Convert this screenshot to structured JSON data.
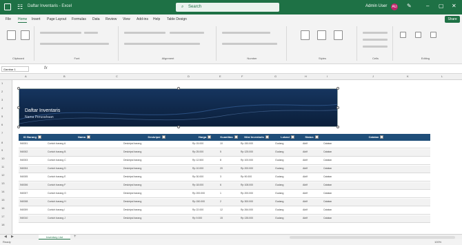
{
  "titlebar": {
    "doc_title": "Daftar Inventaris - Excel",
    "search_placeholder": "Search",
    "user_name": "Admin User",
    "avatar_initials": "AU",
    "accent": "#1e7145"
  },
  "menu": {
    "tabs": [
      "File",
      "Home",
      "Insert",
      "Page Layout",
      "Formulas",
      "Data",
      "Review",
      "View",
      "Add-ins",
      "Help",
      "Table Design"
    ],
    "active_index": 1,
    "share_label": "Share"
  },
  "ribbon": {
    "groups": [
      "Clipboard",
      "Font",
      "Alignment",
      "Number",
      "Styles",
      "Cells",
      "Editing"
    ]
  },
  "formula": {
    "namebox": "Gambar 1",
    "fx": "fx"
  },
  "sheet": {
    "columns": [
      "A",
      "B",
      "C",
      "D",
      "E",
      "F",
      "G",
      "H",
      "I",
      "J",
      "K",
      "L"
    ],
    "rows": [
      "1",
      "2",
      "3",
      "4",
      "5",
      "6",
      "7",
      "8",
      "9",
      "10",
      "11",
      "12",
      "13",
      "14",
      "15",
      "16",
      "17",
      "18"
    ]
  },
  "banner": {
    "title": "Daftar Inventaris",
    "subtitle": "Nama Perusahaan"
  },
  "table": {
    "header_color": "#1f4e79",
    "headers": [
      "ID Barang",
      "Nama",
      "Deskripsi",
      "Harga",
      "Kuantitas",
      "Nilai Inventaris",
      "Lokasi",
      "Status",
      "Catatan"
    ],
    "rows": [
      [
        "IN0001",
        "Contoh barang A",
        "Deskripsi barang",
        "Rp 15.000",
        "10",
        "Rp 150.000",
        "Gudang",
        "Aktif",
        "Catatan"
      ],
      [
        "IN0002",
        "Contoh barang B",
        "Deskripsi barang",
        "Rp 25.000",
        "5",
        "Rp 125.000",
        "Gudang",
        "Aktif",
        "Catatan"
      ],
      [
        "IN0003",
        "Contoh barang C",
        "Deskripsi barang",
        "Rp 12.500",
        "8",
        "Rp 100.000",
        "Gudang",
        "Aktif",
        "Catatan"
      ],
      [
        "IN0004",
        "Contoh barang D",
        "Deskripsi barang",
        "Rp 10.000",
        "20",
        "Rp 200.000",
        "Gudang",
        "Aktif",
        "Catatan"
      ],
      [
        "IN0005",
        "Contoh barang E",
        "Deskripsi barang",
        "Rp 30.000",
        "3",
        "Rp 90.000",
        "Gudang",
        "Aktif",
        "Catatan"
      ],
      [
        "IN0006",
        "Contoh barang F",
        "Deskripsi barang",
        "Rp 18.000",
        "6",
        "Rp 108.000",
        "Gudang",
        "Aktif",
        "Catatan"
      ],
      [
        "IN0007",
        "Contoh barang G",
        "Deskripsi barang",
        "Rp 200.000",
        "1",
        "Rp 200.000",
        "Gudang",
        "Aktif",
        "Catatan"
      ],
      [
        "IN0008",
        "Contoh barang H",
        "Deskripsi barang",
        "Rp 150.000",
        "2",
        "Rp 300.000",
        "Gudang",
        "Aktif",
        "Catatan"
      ],
      [
        "IN0009",
        "Contoh barang I",
        "Deskripsi barang",
        "Rp 22.000",
        "12",
        "Rp 264.000",
        "Gudang",
        "Aktif",
        "Catatan"
      ],
      [
        "IN0010",
        "Contoh barang J",
        "Deskripsi barang",
        "Rp 9.000",
        "15",
        "Rp 135.000",
        "Gudang",
        "Aktif",
        "Catatan"
      ]
    ]
  },
  "tabs_bar": {
    "sheet_name": "Inventory List",
    "add": "+"
  },
  "status": {
    "text": "Ready",
    "zoom": "100%"
  }
}
